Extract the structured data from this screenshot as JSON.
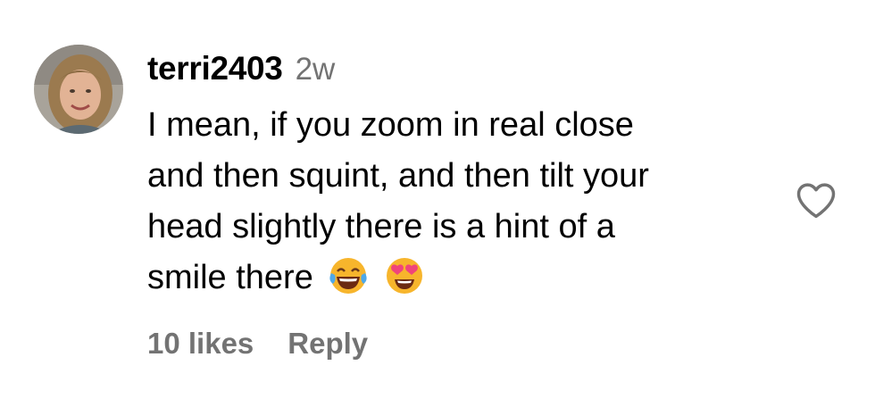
{
  "comment": {
    "username": "terri2403",
    "timestamp": "2w",
    "text_lines": [
      "I mean, if you zoom in real close",
      "and then squint, and then tilt your",
      "head slightly there is a hint of a",
      "smile there"
    ],
    "emojis": [
      "face-with-tears-of-joy",
      "smiling-face-with-heart-eyes"
    ],
    "likes_label": "10 likes",
    "reply_label": "Reply"
  },
  "icons": {
    "like": "heart-outline-icon"
  },
  "colors": {
    "text": "#000000",
    "secondary": "#737373",
    "emoji_yellow": "#F7B52C",
    "heart_eyes": "#F0457A"
  }
}
